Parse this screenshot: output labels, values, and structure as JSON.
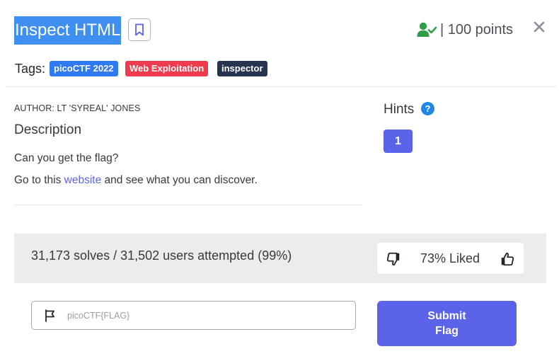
{
  "challenge": {
    "title": "Inspect HTML",
    "points": "| 100 points",
    "tags_label": "Tags:",
    "tags": [
      "picoCTF 2022",
      "Web Exploitation",
      "inspector"
    ],
    "author": "AUTHOR: LT 'SYREAL' JONES",
    "description_heading": "Description",
    "description_line1": "Can you get the flag?",
    "description_line2_before": "Go to this ",
    "description_link": "website",
    "description_line2_after": " and see what you can discover."
  },
  "hints": {
    "label": "Hints",
    "help_icon": "?",
    "buttons": [
      "1"
    ]
  },
  "stats": {
    "solves_text": "31,173 solves / 31,502 users attempted (99%)",
    "liked_text": "73% Liked"
  },
  "flag_form": {
    "placeholder": "picoCTF{FLAG}",
    "value": "",
    "submit_label": "Submit Flag"
  },
  "icons": {
    "bookmark": "bookmark-icon",
    "solved": "user-check-icon",
    "close": "close-icon",
    "thumbs_down": "thumbs-down-icon",
    "thumbs_up": "thumbs-up-icon",
    "flag": "flag-icon"
  },
  "colors": {
    "accent": "#5b63e8",
    "solved_green": "#2e9e46",
    "tag_event": "#2f7af1",
    "tag_category": "#ef3b4d",
    "tag_tool": "#273451",
    "title_highlight": "#3f8ff1",
    "help_blue": "#1e88e5"
  }
}
